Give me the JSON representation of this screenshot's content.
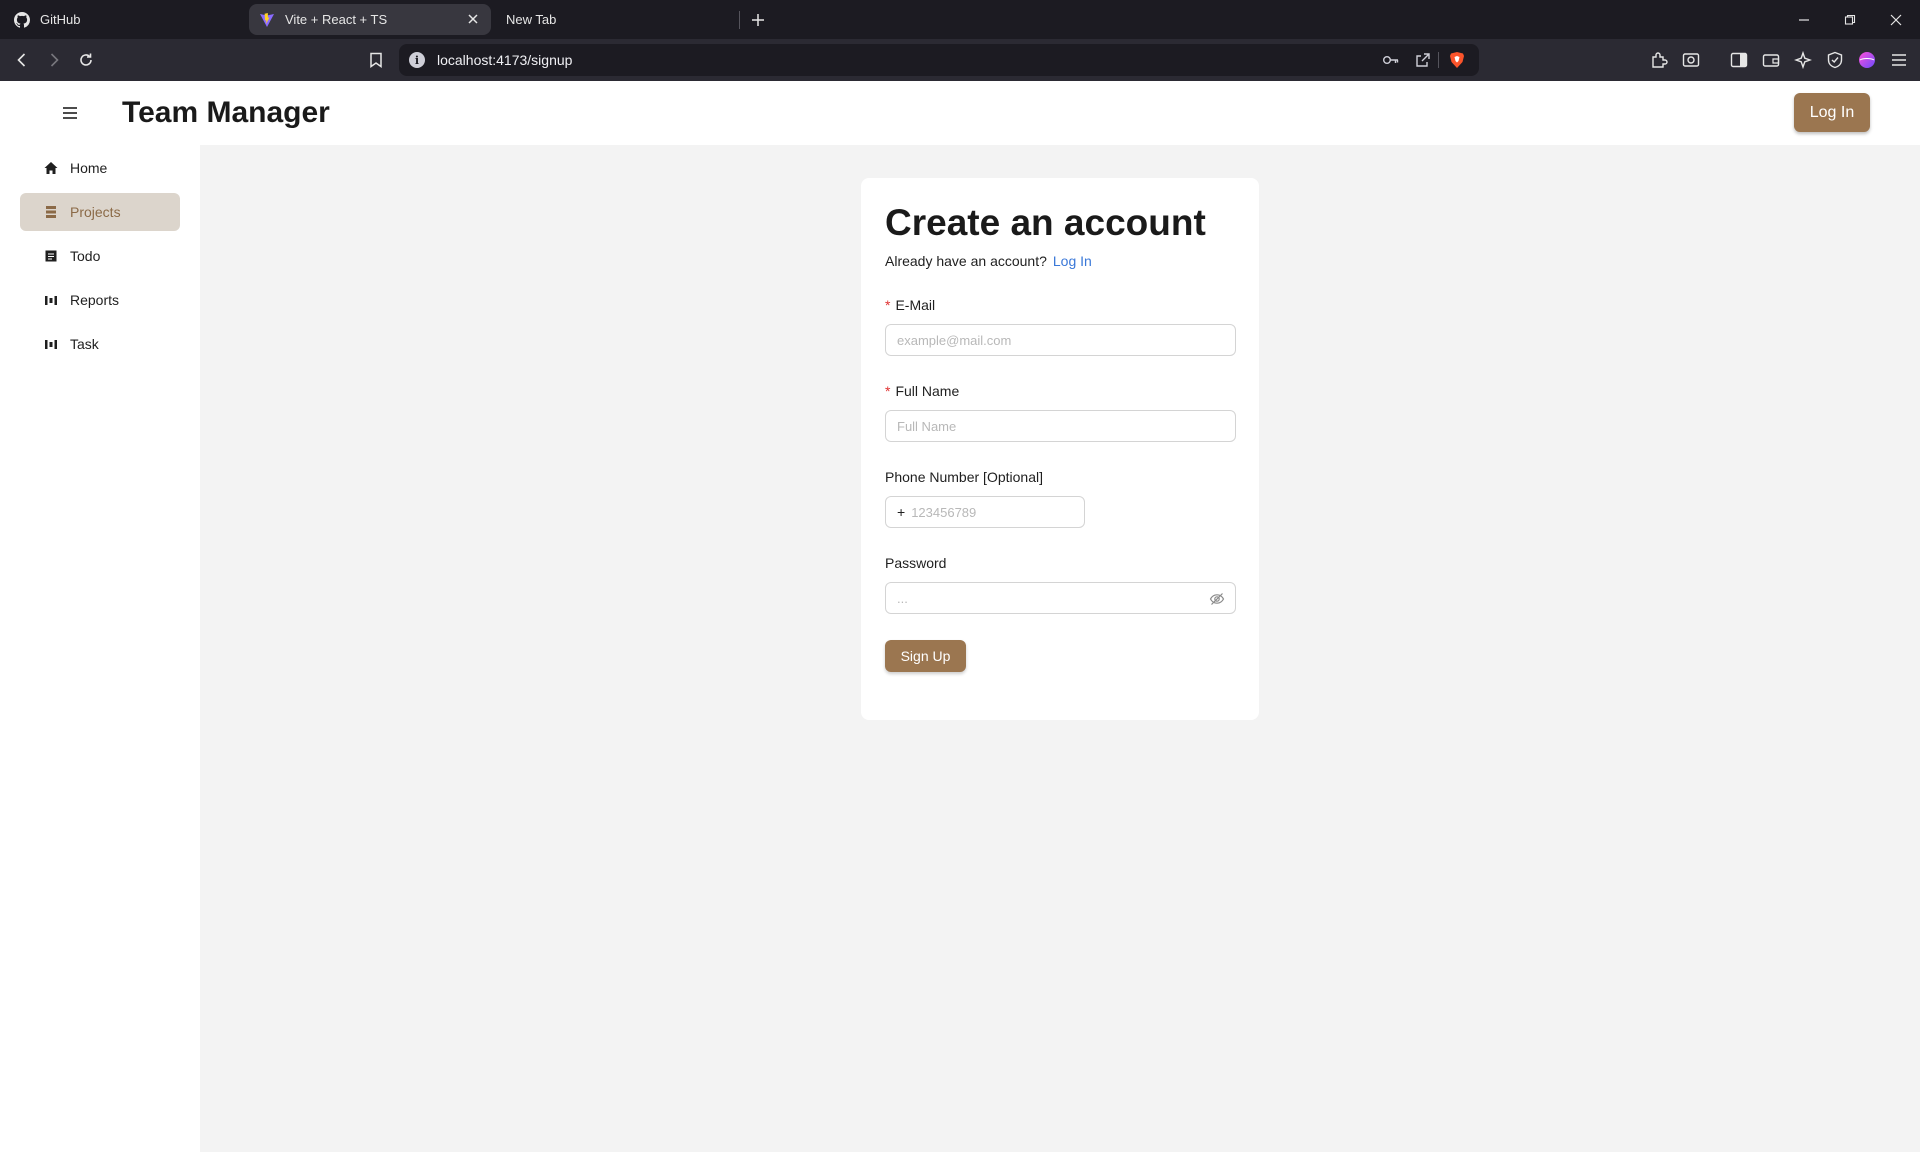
{
  "browser": {
    "tabs": [
      {
        "title": "GitHub",
        "icon": "github-icon"
      },
      {
        "title": "Vite + React + TS",
        "icon": "vite-icon",
        "active": true
      },
      {
        "title": "New Tab",
        "icon": ""
      }
    ],
    "url": "localhost:4173/signup"
  },
  "header": {
    "title": "Team Manager",
    "login_label": "Log In"
  },
  "sidebar": {
    "items": [
      {
        "label": "Home",
        "icon": "home-icon"
      },
      {
        "label": "Projects",
        "icon": "projects-icon",
        "active": true
      },
      {
        "label": "Todo",
        "icon": "todo-icon"
      },
      {
        "label": "Reports",
        "icon": "reports-icon"
      },
      {
        "label": "Task",
        "icon": "task-icon"
      }
    ]
  },
  "form": {
    "title": "Create an account",
    "subtitle": "Already have an account?",
    "login_link": "Log In",
    "email": {
      "required_mark": "*",
      "label": "E-Mail",
      "placeholder": "example@mail.com",
      "value": ""
    },
    "full_name": {
      "required_mark": "*",
      "label": "Full Name",
      "placeholder": "Full Name",
      "value": ""
    },
    "phone": {
      "label": "Phone Number [Optional]",
      "prefix": "+",
      "placeholder": "123456789",
      "value": ""
    },
    "password": {
      "label": "Password",
      "placeholder": "...",
      "value": ""
    },
    "submit_label": "Sign Up"
  },
  "colors": {
    "accent": "#9b7650",
    "sidebar_active_bg": "#dcd5cc",
    "link": "#3a78d8",
    "required": "#e03131"
  }
}
